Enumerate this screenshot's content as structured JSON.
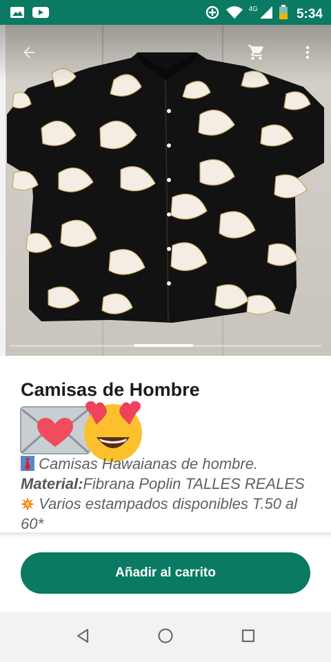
{
  "status_bar": {
    "time": "5:34",
    "network": "4G",
    "icons": [
      "image-icon",
      "youtube-icon",
      "data-saver-icon",
      "wifi-icon",
      "signal-icon",
      "battery-icon"
    ],
    "bar_color": "#0a7a62"
  },
  "toolbar": {
    "back_icon": "arrow-back-icon",
    "cart_icon": "cart-icon",
    "menu_icon": "more-vert-icon"
  },
  "product": {
    "image_alt": "black shirt with white floral print",
    "title": "Camisas de Hombre",
    "emojis": [
      "love-letter-emoji",
      "heart-eyes-emoji"
    ],
    "desc_prefix": "Camisas Hawaianas de hombre.",
    "material_label": "Material:",
    "desc_material": "Fibrana Poplin TALLES REALES",
    "desc_suffix": " Varios estampados disponibles T.50 al 60*",
    "emoji_icons": [
      "necktie-emoji",
      "collision-emoji"
    ]
  },
  "actions": {
    "add_to_cart": "Añadir al carrito",
    "button_color": "#0a7a62"
  },
  "nav": {
    "icons": [
      "back-triangle-icon",
      "home-circle-icon",
      "recents-square-icon"
    ]
  }
}
